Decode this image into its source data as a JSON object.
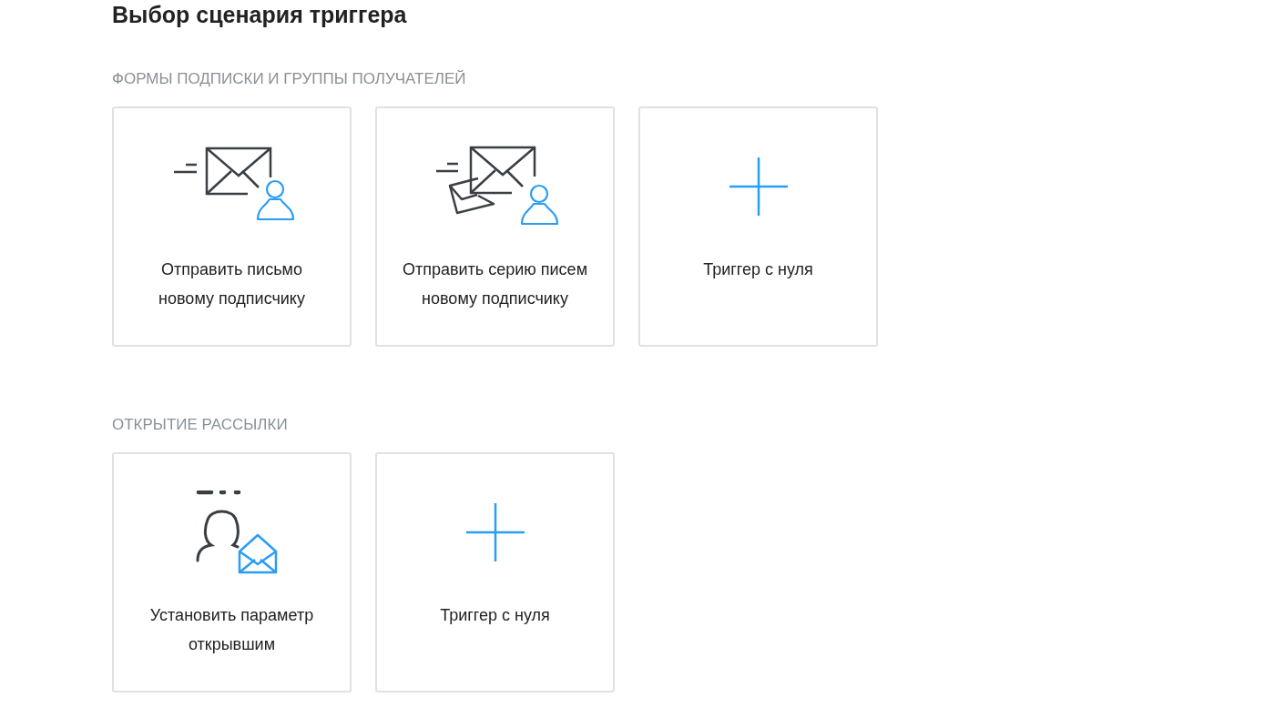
{
  "title": "Выбор сценария триггера",
  "sections": [
    {
      "heading": "ФОРМЫ ПОДПИСКИ И ГРУППЫ ПОЛУЧАТЕЛЕЙ",
      "cards": [
        {
          "kind": "mail-user",
          "label": "Отправить письмо новому подписчику"
        },
        {
          "kind": "mail-series-user",
          "label": "Отправить серию писем новому подписчику"
        },
        {
          "kind": "plus",
          "label": "Триггер с нуля"
        }
      ]
    },
    {
      "heading": "ОТКРЫТИЕ РАССЫЛКИ",
      "cards": [
        {
          "kind": "user-open-mail",
          "label": "Установить параметр открывшим"
        },
        {
          "kind": "plus",
          "label": "Триггер с нуля"
        }
      ]
    }
  ]
}
